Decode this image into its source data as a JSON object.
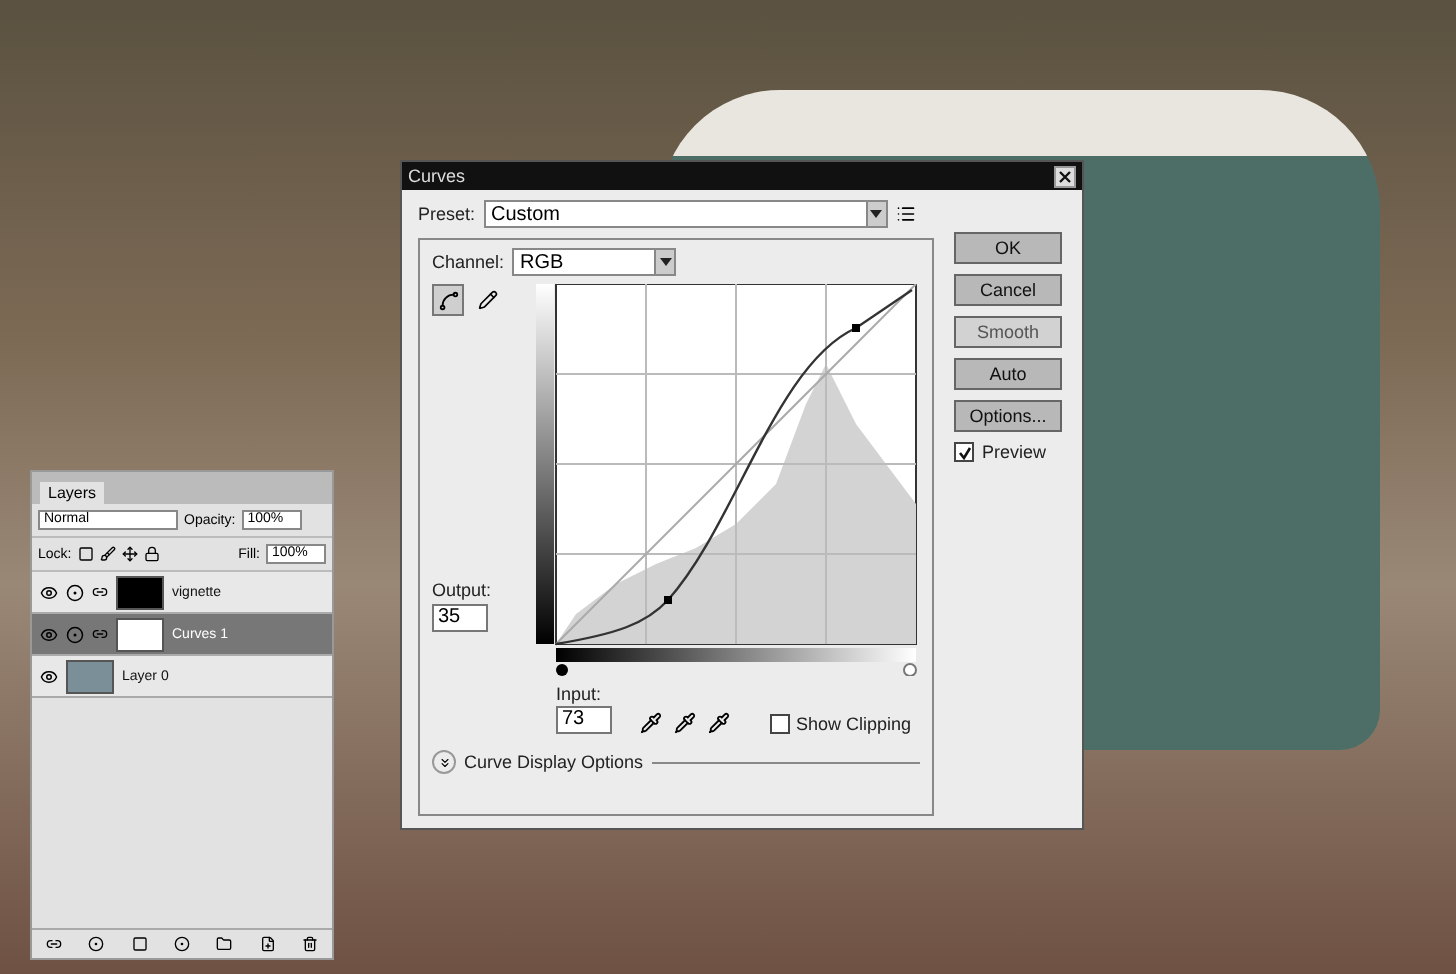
{
  "curves_dialog": {
    "title": "Curves",
    "preset_label": "Preset:",
    "preset": "Custom",
    "channel_label": "Channel:",
    "channel": "RGB",
    "tools": [
      {
        "kind": "curve",
        "selected": true
      },
      {
        "kind": "pencil",
        "selected": false
      }
    ],
    "output_label": "Output:",
    "output": "35",
    "input_label": "Input:",
    "input": "73",
    "show_clipping": {
      "label": "Show Clipping",
      "checked": false
    },
    "display_options": "Curve Display Options",
    "input_sliders": [
      {
        "kind": "shadow",
        "level": 0
      },
      {
        "kind": "highlight",
        "level": 1
      }
    ],
    "buttons": [
      {
        "label": "OK",
        "disabled": false
      },
      {
        "label": "Cancel",
        "disabled": false
      },
      {
        "label": "Smooth",
        "disabled": true
      },
      {
        "label": "Auto",
        "disabled": false
      },
      {
        "label": "Options...",
        "disabled": false
      }
    ],
    "preview": {
      "label": "Preview",
      "checked": true
    }
  },
  "layers_panel": {
    "tab": "Layers",
    "blend_mode": "Normal",
    "opacity_label": "Opacity:",
    "opacity": "100%",
    "lock_label": "Lock:",
    "fill_label": "Fill:",
    "fill": "100%",
    "layers": [
      {
        "name": "vignette",
        "kind": "adjustment",
        "color": "#000000",
        "selected": false
      },
      {
        "name": "Curves 1",
        "kind": "adjustment",
        "color": "#ffffff",
        "selected": true
      },
      {
        "name": "Layer 0",
        "kind": "image",
        "selected": false
      }
    ]
  }
}
